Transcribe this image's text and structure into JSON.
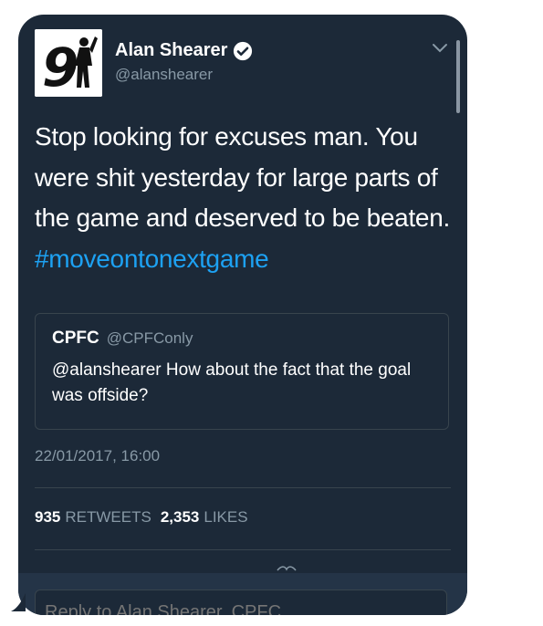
{
  "profile": {
    "name": "Alan Shearer",
    "handle": "@alanshearer",
    "avatar_number": "9",
    "verified": true
  },
  "tweet": {
    "text": "Stop looking for excuses man. You were shit yesterday for large parts of the game and deserved to be beaten.",
    "hashtag": "#moveontonextgame"
  },
  "quoted_tweet": {
    "name": "CPFC",
    "handle": "@CPFConly",
    "text": "@alanshearer How about the fact that the goal was offside?"
  },
  "timestamp": "22/01/2017, 16:00",
  "stats": {
    "retweets_count": "935",
    "retweets_label": "RETWEETS",
    "likes_count": "2,353",
    "likes_label": "LIKES"
  },
  "reply": {
    "placeholder": "Reply to Alan Shearer, CPFC"
  },
  "colors": {
    "background": "#1c2938",
    "accent": "#1da1f2",
    "muted_text": "#8899a6",
    "border": "#38444d"
  },
  "icons": {
    "verified": "verified-badge-icon",
    "menu": "chevron-down-icon"
  }
}
